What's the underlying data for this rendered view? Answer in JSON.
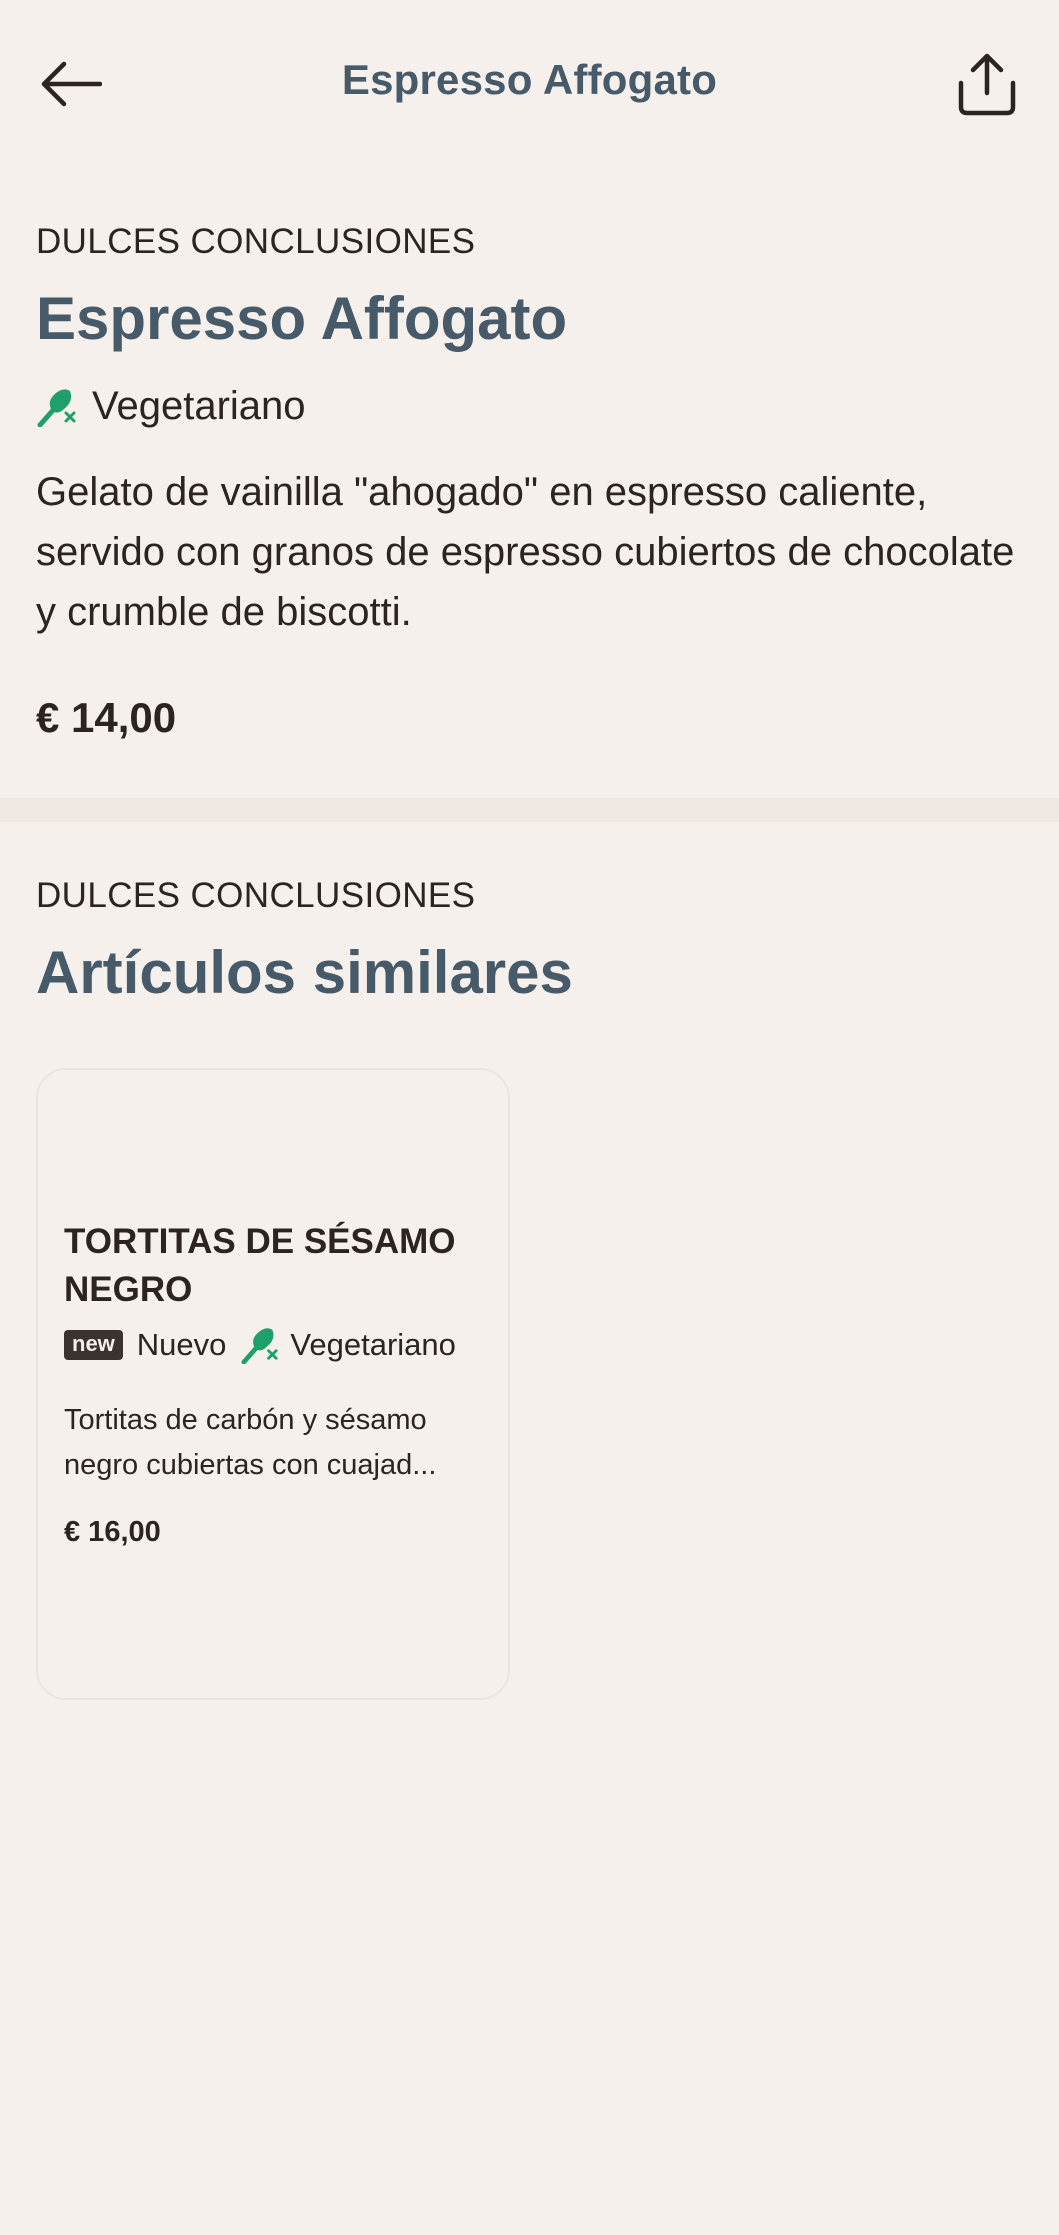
{
  "header": {
    "title": "Espresso Affogato",
    "back_icon": "arrow-left-icon",
    "share_icon": "share-icon"
  },
  "item": {
    "category": "DULCES CONCLUSIONES",
    "title": "Espresso Affogato",
    "diet_tag": "Vegetariano",
    "description": "Gelato de vainilla \"ahogado\" en espresso caliente, servido con granos de espresso cubiertos de chocolate y crumble de biscotti.",
    "price": "€ 14,00"
  },
  "similar": {
    "category": "DULCES CONCLUSIONES",
    "title": "Artículos similares",
    "cards": [
      {
        "title": "TORTITAS DE SÉSAMO NEGRO",
        "badge": "new",
        "badge_label": "Nuevo",
        "diet_tag": "Vegetariano",
        "description": "Tortitas de carbón y sésamo negro cubiertas con cuajad...",
        "price": "€ 16,00"
      }
    ]
  },
  "colors": {
    "background": "#f6f0ec",
    "title_accent": "#465a69",
    "vegetarian_icon": "#1fa06a",
    "text": "#2b2420"
  }
}
